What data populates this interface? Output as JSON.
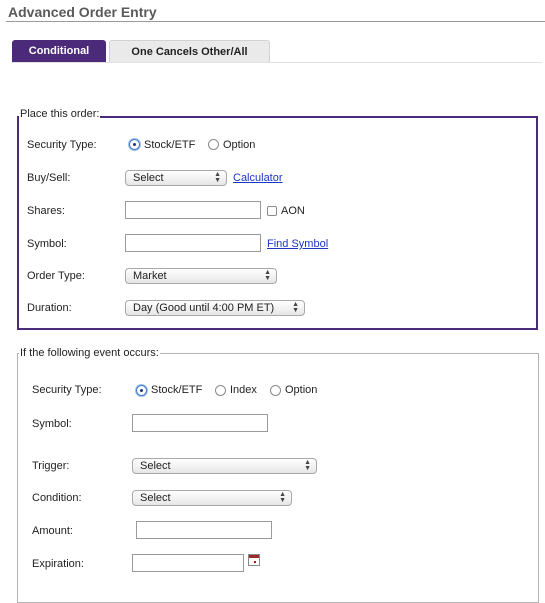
{
  "page": {
    "title": "Advanced Order Entry"
  },
  "tabs": {
    "conditional": "Conditional",
    "one_cancels": "One Cancels Other/All"
  },
  "place_order": {
    "legend": "Place this order:",
    "security_type_label": "Security Type:",
    "security_stock": "Stock/ETF",
    "security_option": "Option",
    "buy_sell_label": "Buy/Sell:",
    "buy_sell_value": "Select",
    "calculator": "Calculator",
    "shares_label": "Shares:",
    "aon": "AON",
    "symbol_label": "Symbol:",
    "find_symbol": "Find Symbol",
    "order_type_label": "Order Type:",
    "order_type_value": "Market",
    "duration_label": "Duration:",
    "duration_value": "Day (Good until 4:00 PM ET)"
  },
  "event": {
    "legend": "If the following event occurs:",
    "security_type_label": "Security Type:",
    "security_stock": "Stock/ETF",
    "security_index": "Index",
    "security_option": "Option",
    "symbol_label": "Symbol:",
    "trigger_label": "Trigger:",
    "trigger_value": "Select",
    "condition_label": "Condition:",
    "condition_value": "Select",
    "amount_label": "Amount:",
    "expiration_label": "Expiration:"
  },
  "icons": {
    "calendar": "calendar-icon",
    "select_arrows": "updown-arrows-icon"
  },
  "colors": {
    "accent": "#4b2a7a",
    "link": "#1d35c6"
  }
}
